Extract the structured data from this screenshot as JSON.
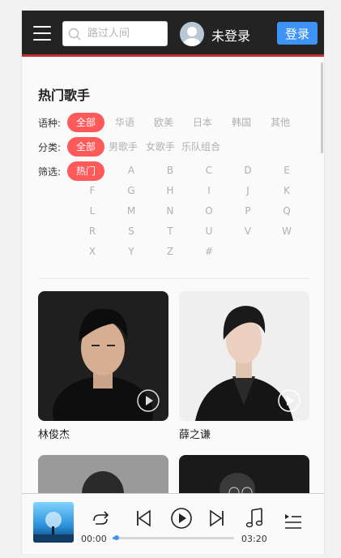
{
  "header": {
    "search_placeholder": "路过人间",
    "username": "未登录",
    "login_label": "登录"
  },
  "singers": {
    "title": "热门歌手",
    "language_label": "语种:",
    "languages": [
      "全部",
      "华语",
      "欧美",
      "日本",
      "韩国",
      "其他"
    ],
    "category_label": "分类:",
    "categories": [
      "全部",
      "男歌手",
      "女歌手",
      "乐队组合"
    ],
    "filter_label": "筛选:",
    "letters": [
      "热门",
      "A",
      "B",
      "C",
      "D",
      "E",
      "F",
      "G",
      "H",
      "I",
      "J",
      "K",
      "L",
      "M",
      "N",
      "O",
      "P",
      "Q",
      "R",
      "S",
      "T",
      "U",
      "V",
      "W",
      "X",
      "Y",
      "Z",
      "#"
    ],
    "list": [
      {
        "name": "林俊杰"
      },
      {
        "name": "薛之谦"
      }
    ]
  },
  "player": {
    "current_time": "00:00",
    "total_time": "03:20",
    "progress": 0.03
  },
  "colors": {
    "accent": "#ff5a5a",
    "header_bg": "#232323",
    "header_border": "#c62f2f",
    "primary_blue": "#3d94f6"
  }
}
